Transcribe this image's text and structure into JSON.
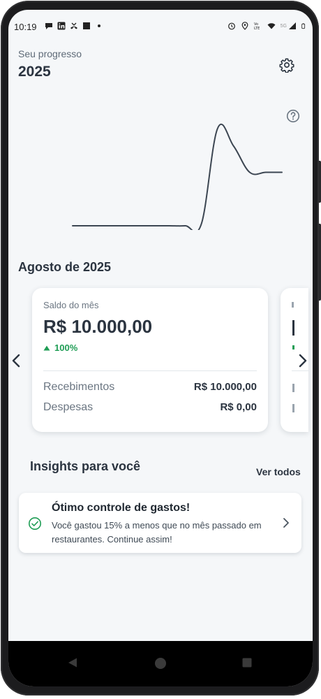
{
  "status_bar": {
    "time": "10:19",
    "left_icons": [
      "chat-icon",
      "linkedin-icon",
      "missed-call-icon",
      "square-icon",
      "dot-icon"
    ],
    "right_icons": [
      "alarm-icon",
      "location-icon",
      "volte-icon",
      "wifi-icon",
      "signal-icon",
      "battery-icon"
    ],
    "network_label": "5G"
  },
  "header": {
    "subtitle": "Seu progresso",
    "title": "2025",
    "settings_icon": "gear-icon",
    "help_icon": "question-circle-icon"
  },
  "chart_data": {
    "type": "line",
    "title": "",
    "xlabel": "",
    "ylabel": "",
    "grid": false,
    "series": [
      {
        "values": [
          0,
          0,
          0,
          0,
          0,
          0,
          0,
          0,
          0.02,
          1.0,
          0.82,
          0.55,
          0.55,
          0.55
        ]
      }
    ],
    "ylim": [
      0,
      1.05
    ]
  },
  "month": {
    "title": "Agosto de 2025",
    "prev_icon": "chevron-left-icon",
    "next_icon": "chevron-right-icon"
  },
  "balance_card": {
    "label": "Saldo do mês",
    "amount": "R$ 10.000,00",
    "change": "100%",
    "change_icon": "triangle-up-icon",
    "change_color": "#1f9d55",
    "rows": [
      {
        "label": "Recebimentos",
        "value": "R$ 10.000,00"
      },
      {
        "label": "Despesas",
        "value": "R$ 0,00"
      }
    ]
  },
  "insights": {
    "title": "Insights para você",
    "see_all": "Ver todos",
    "items": [
      {
        "title": "Ótimo controle de gastos!",
        "description": "Você gastou 15% a menos que no mês passado em restaurantes. Continue assim!",
        "icon": "check-circle-icon"
      }
    ]
  },
  "system_nav": {
    "back_icon": "back-triangle-icon",
    "home_icon": "home-circle-icon",
    "recents_icon": "recents-square-icon"
  },
  "colors": {
    "background": "#f5f7f9",
    "text_primary": "#2b3440",
    "text_secondary": "#6b7682",
    "accent_green": "#1f9d55"
  }
}
